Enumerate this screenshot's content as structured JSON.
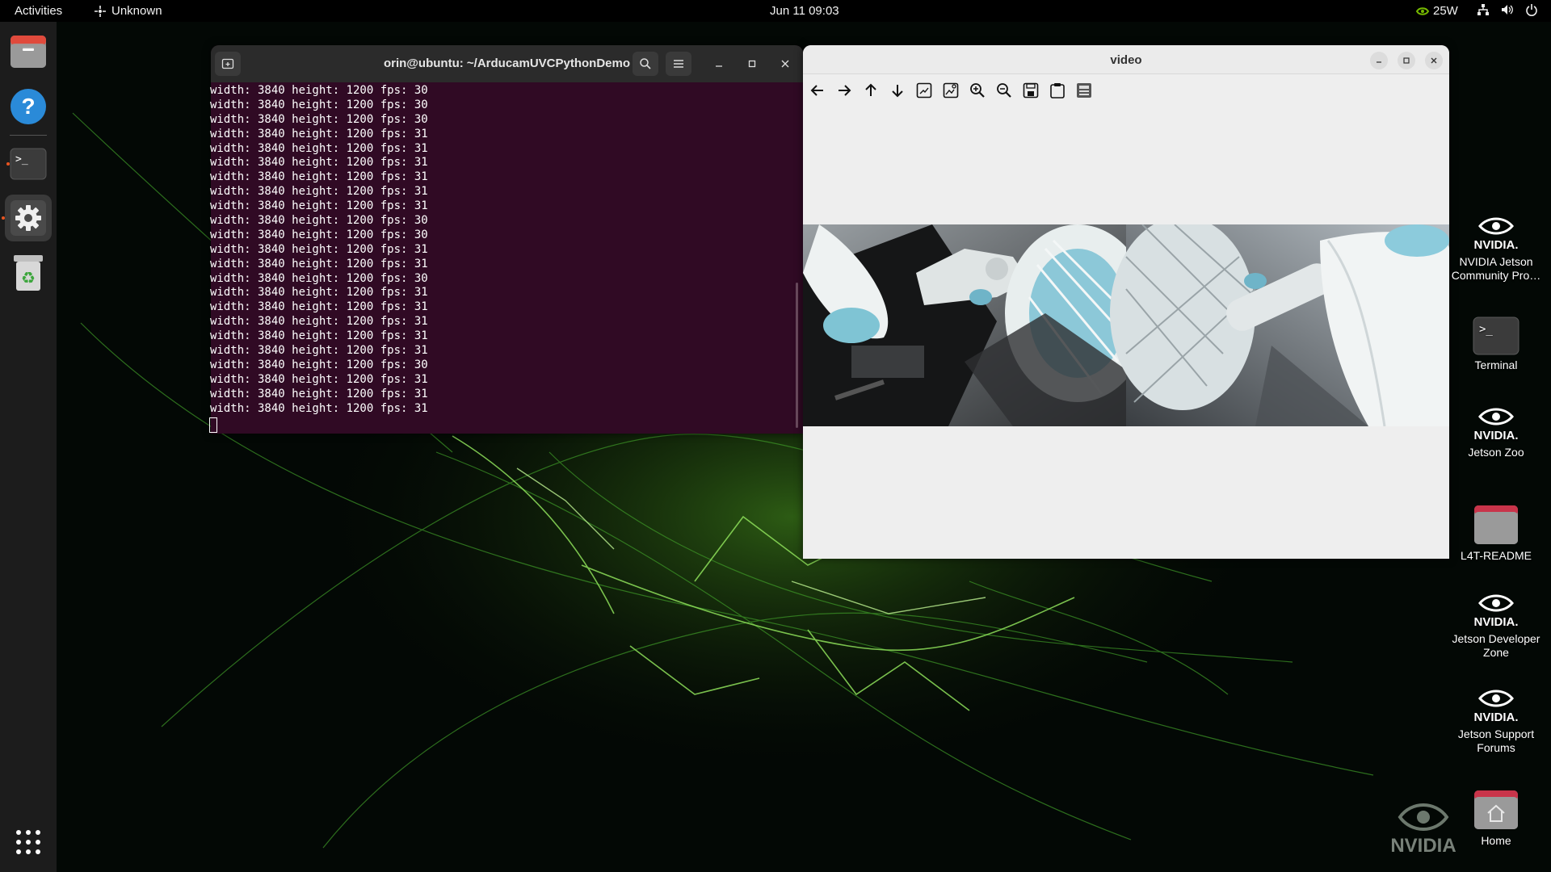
{
  "topbar": {
    "activities": "Activities",
    "app_menu": "Unknown",
    "clock": "Jun 11  09:03",
    "power_mode": "25W",
    "icons": [
      "network-icon",
      "volume-icon",
      "power-icon"
    ]
  },
  "dock": {
    "items": [
      "files-icon",
      "help-icon",
      "terminal-icon",
      "settings-icon",
      "trash-icon"
    ],
    "show_apps": "show-apps-icon"
  },
  "terminal": {
    "title": "orin@ubuntu: ~/ArducamUVCPythonDemo",
    "lines": [
      "width: 3840 height: 1200 fps: 30",
      "width: 3840 height: 1200 fps: 30",
      "width: 3840 height: 1200 fps: 30",
      "width: 3840 height: 1200 fps: 31",
      "width: 3840 height: 1200 fps: 31",
      "width: 3840 height: 1200 fps: 31",
      "width: 3840 height: 1200 fps: 31",
      "width: 3840 height: 1200 fps: 31",
      "width: 3840 height: 1200 fps: 31",
      "width: 3840 height: 1200 fps: 30",
      "width: 3840 height: 1200 fps: 30",
      "width: 3840 height: 1200 fps: 31",
      "width: 3840 height: 1200 fps: 31",
      "width: 3840 height: 1200 fps: 30",
      "width: 3840 height: 1200 fps: 31",
      "width: 3840 height: 1200 fps: 31",
      "width: 3840 height: 1200 fps: 31",
      "width: 3840 height: 1200 fps: 31",
      "width: 3840 height: 1200 fps: 31",
      "width: 3840 height: 1200 fps: 30",
      "width: 3840 height: 1200 fps: 31",
      "width: 3840 height: 1200 fps: 31",
      "width: 3840 height: 1200 fps: 31"
    ]
  },
  "video": {
    "title": "video",
    "toolbar": [
      "pan-left-icon",
      "pan-right-icon",
      "pan-up-icon",
      "pan-down-icon",
      "zoom-fit-icon",
      "zoom-original-icon",
      "zoom-in-icon",
      "zoom-out-icon",
      "save-icon",
      "copy-icon",
      "properties-icon"
    ]
  },
  "desktop": {
    "icons": [
      {
        "label": "NVIDIA Jetson Community Pro…"
      },
      {
        "label": "Terminal"
      },
      {
        "label": "Jetson Zoo"
      },
      {
        "label": "L4T-README"
      },
      {
        "label": "Jetson Developer Zone"
      },
      {
        "label": "Jetson Support Forums"
      },
      {
        "label": "Home"
      }
    ],
    "watermark": "NVIDIA"
  },
  "colors": {
    "terminal_bg": "#300a24",
    "accent": "#e95420",
    "nvidia_green": "#76b900"
  }
}
